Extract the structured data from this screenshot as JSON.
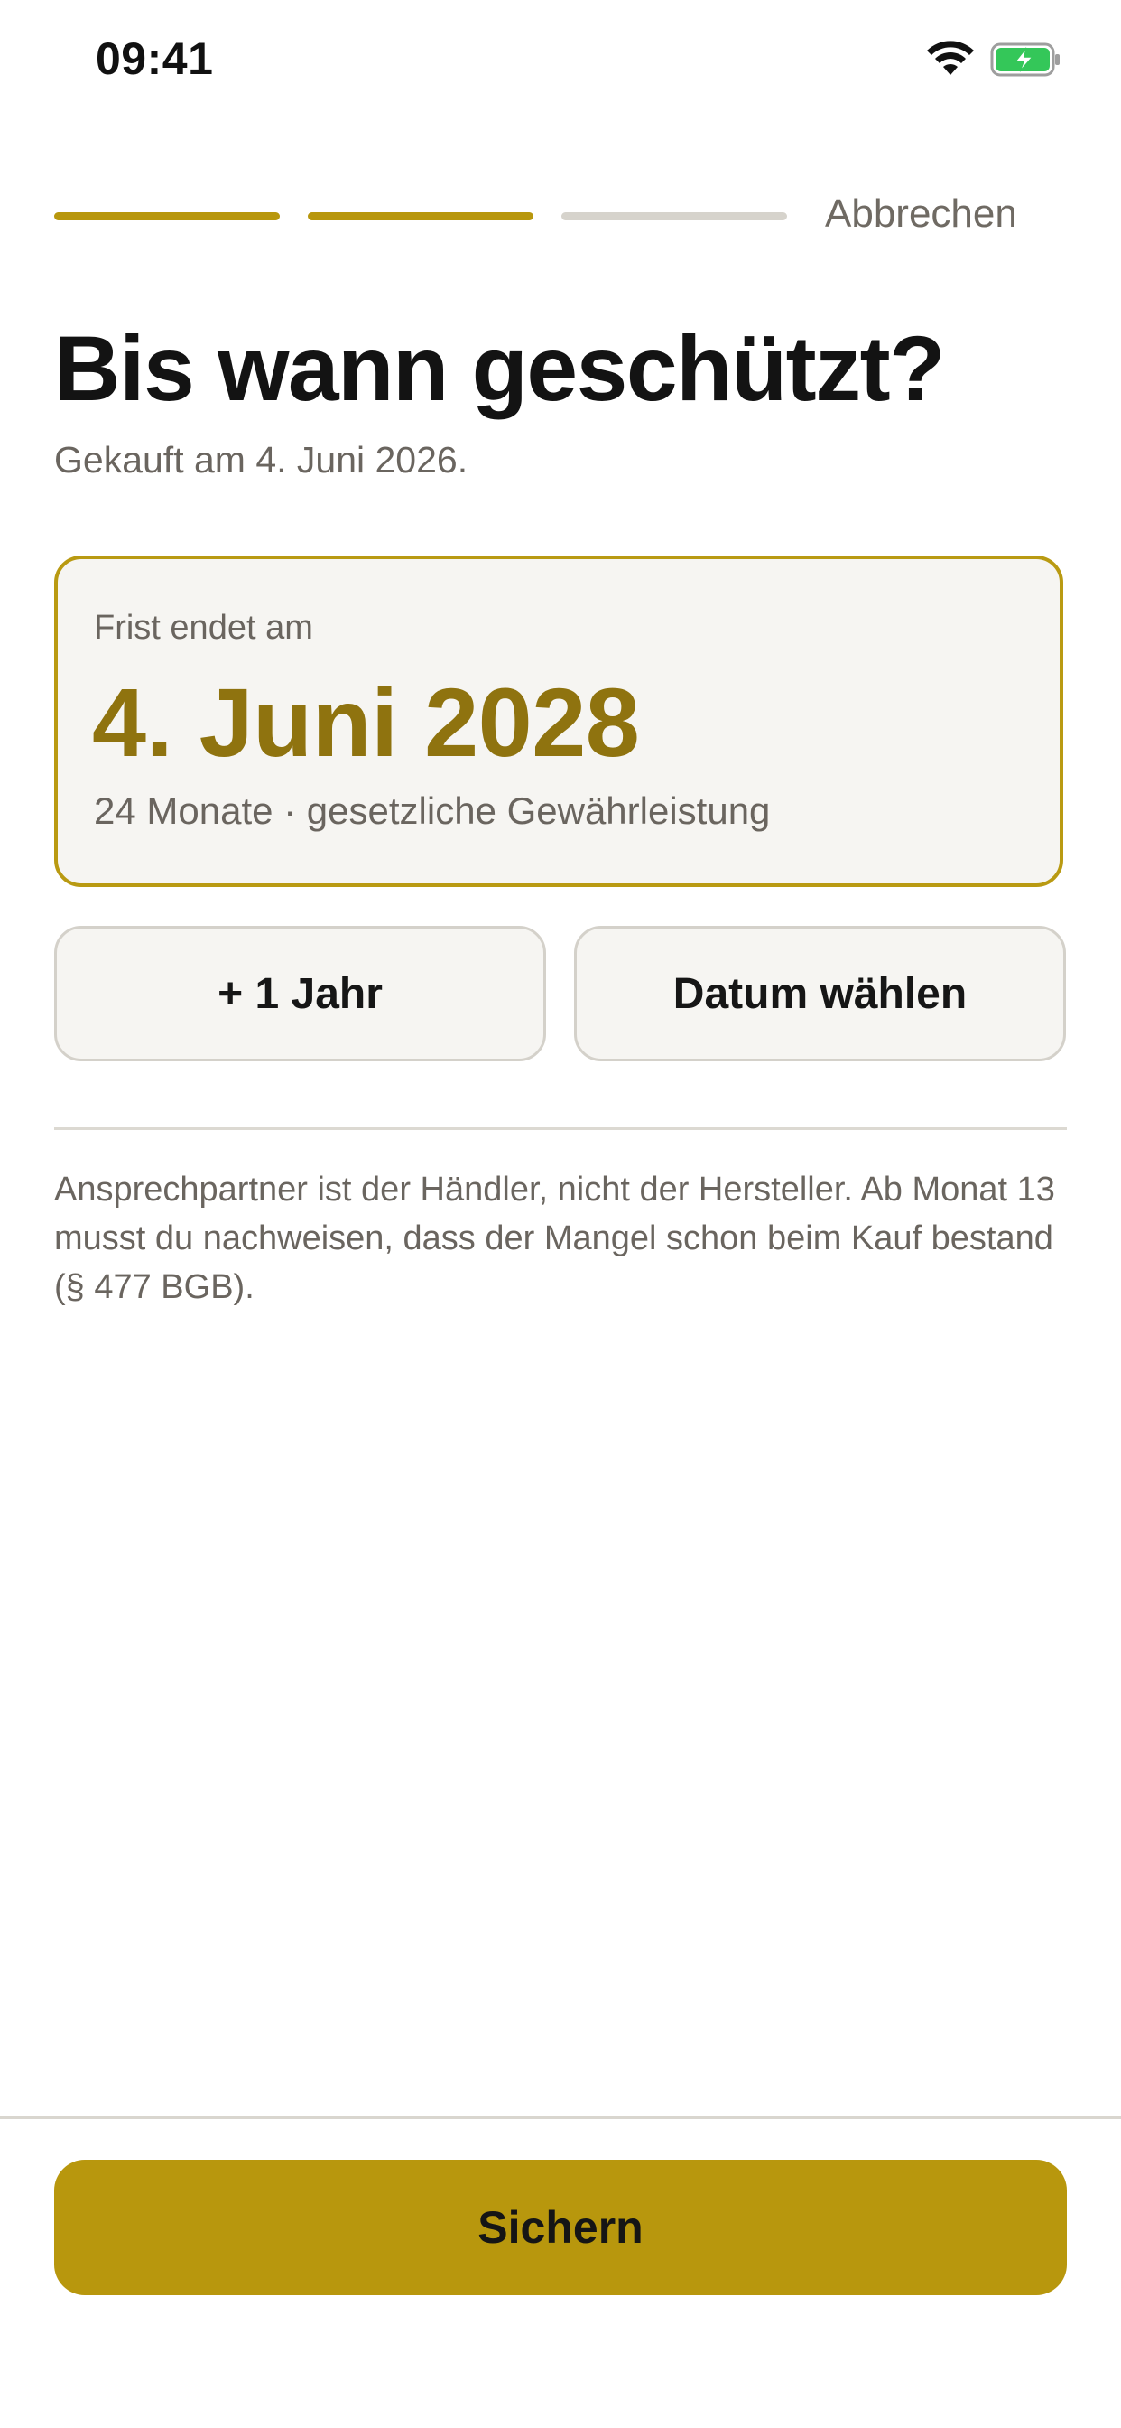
{
  "status_bar": {
    "time": "09:41",
    "wifi_icon": "wifi-icon",
    "battery_icon": "battery-charging-icon",
    "battery_color": "#34c759"
  },
  "progress": {
    "steps_total": 3,
    "steps_completed": 2,
    "active_color": "#b8970d",
    "inactive_color": "#d6d3cc"
  },
  "header": {
    "cancel_label": "Abbrechen"
  },
  "main": {
    "title": "Bis wann geschützt?",
    "purchase_note": "Gekauft am 4. Juni 2026."
  },
  "deadline_card": {
    "label": "Frist endet am",
    "date": "4. Juni 2028",
    "detail": "24 Monate · gesetzliche Gewährleistung",
    "accent_color": "#8f730f"
  },
  "actions": {
    "add_year_label": "+ 1 Jahr",
    "pick_date_label": "Datum wählen"
  },
  "info": {
    "text": "Ansprechpartner ist der Händler, nicht der Hersteller. Ab Monat 13 musst du nachweisen, dass der Mangel schon beim Kauf bestand (§ 477 BGB)."
  },
  "footer": {
    "save_label": "Sichern",
    "button_color": "#b8970d"
  }
}
